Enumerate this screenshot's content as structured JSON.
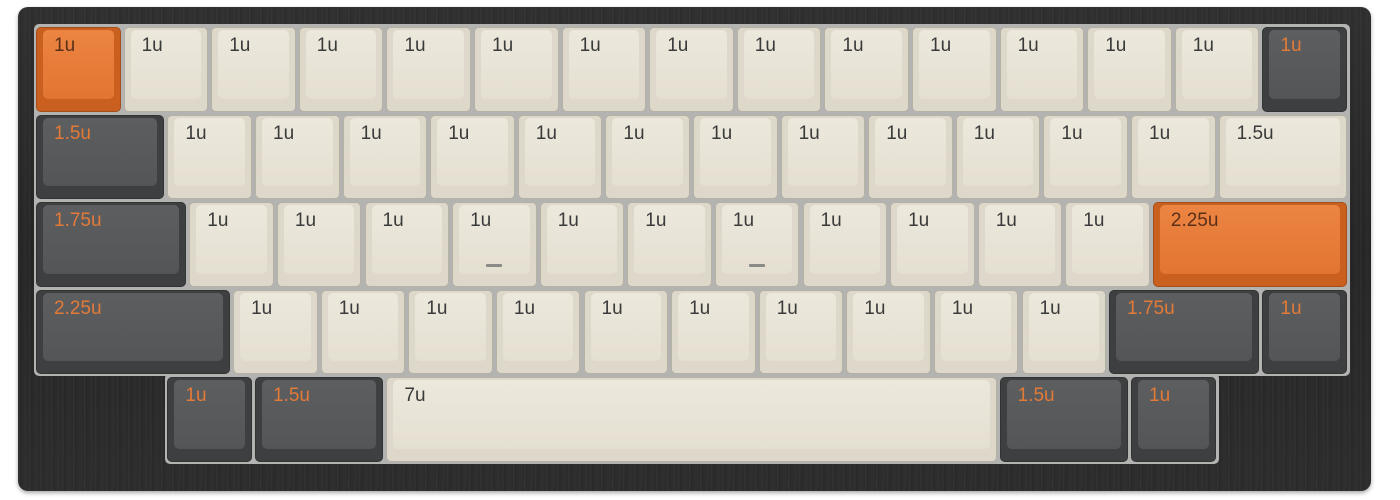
{
  "keyboard": {
    "colors": {
      "alpha_cap": "#ece8dc",
      "alpha_legend": "#3a3a3a",
      "modifier_cap": "#5c5e60",
      "modifier_legend": "#e37a38",
      "accent_cap": "#ec8442",
      "accent_legend": "#5a3018",
      "case": "#2b2b2b",
      "plate": "#b3b3b1"
    },
    "rows": [
      [
        {
          "legend": "1u",
          "width_u": 1,
          "color": "orange"
        },
        {
          "legend": "1u",
          "width_u": 1,
          "color": "beige"
        },
        {
          "legend": "1u",
          "width_u": 1,
          "color": "beige"
        },
        {
          "legend": "1u",
          "width_u": 1,
          "color": "beige"
        },
        {
          "legend": "1u",
          "width_u": 1,
          "color": "beige"
        },
        {
          "legend": "1u",
          "width_u": 1,
          "color": "beige"
        },
        {
          "legend": "1u",
          "width_u": 1,
          "color": "beige"
        },
        {
          "legend": "1u",
          "width_u": 1,
          "color": "beige"
        },
        {
          "legend": "1u",
          "width_u": 1,
          "color": "beige"
        },
        {
          "legend": "1u",
          "width_u": 1,
          "color": "beige"
        },
        {
          "legend": "1u",
          "width_u": 1,
          "color": "beige"
        },
        {
          "legend": "1u",
          "width_u": 1,
          "color": "beige"
        },
        {
          "legend": "1u",
          "width_u": 1,
          "color": "beige"
        },
        {
          "legend": "1u",
          "width_u": 1,
          "color": "beige"
        },
        {
          "legend": "1u",
          "width_u": 1,
          "color": "dark"
        }
      ],
      [
        {
          "legend": "1.5u",
          "width_u": 1.5,
          "color": "dark"
        },
        {
          "legend": "1u",
          "width_u": 1,
          "color": "beige"
        },
        {
          "legend": "1u",
          "width_u": 1,
          "color": "beige"
        },
        {
          "legend": "1u",
          "width_u": 1,
          "color": "beige"
        },
        {
          "legend": "1u",
          "width_u": 1,
          "color": "beige"
        },
        {
          "legend": "1u",
          "width_u": 1,
          "color": "beige"
        },
        {
          "legend": "1u",
          "width_u": 1,
          "color": "beige"
        },
        {
          "legend": "1u",
          "width_u": 1,
          "color": "beige"
        },
        {
          "legend": "1u",
          "width_u": 1,
          "color": "beige"
        },
        {
          "legend": "1u",
          "width_u": 1,
          "color": "beige"
        },
        {
          "legend": "1u",
          "width_u": 1,
          "color": "beige"
        },
        {
          "legend": "1u",
          "width_u": 1,
          "color": "beige"
        },
        {
          "legend": "1u",
          "width_u": 1,
          "color": "beige"
        },
        {
          "legend": "1.5u",
          "width_u": 1.5,
          "color": "beige"
        }
      ],
      [
        {
          "legend": "1.75u",
          "width_u": 1.75,
          "color": "dark"
        },
        {
          "legend": "1u",
          "width_u": 1,
          "color": "beige"
        },
        {
          "legend": "1u",
          "width_u": 1,
          "color": "beige"
        },
        {
          "legend": "1u",
          "width_u": 1,
          "color": "beige"
        },
        {
          "legend": "1u",
          "width_u": 1,
          "color": "beige",
          "homing": true
        },
        {
          "legend": "1u",
          "width_u": 1,
          "color": "beige"
        },
        {
          "legend": "1u",
          "width_u": 1,
          "color": "beige"
        },
        {
          "legend": "1u",
          "width_u": 1,
          "color": "beige",
          "homing": true
        },
        {
          "legend": "1u",
          "width_u": 1,
          "color": "beige"
        },
        {
          "legend": "1u",
          "width_u": 1,
          "color": "beige"
        },
        {
          "legend": "1u",
          "width_u": 1,
          "color": "beige"
        },
        {
          "legend": "1u",
          "width_u": 1,
          "color": "beige"
        },
        {
          "legend": "2.25u",
          "width_u": 2.25,
          "color": "orange"
        }
      ],
      [
        {
          "legend": "2.25u",
          "width_u": 2.25,
          "color": "dark"
        },
        {
          "legend": "1u",
          "width_u": 1,
          "color": "beige"
        },
        {
          "legend": "1u",
          "width_u": 1,
          "color": "beige"
        },
        {
          "legend": "1u",
          "width_u": 1,
          "color": "beige"
        },
        {
          "legend": "1u",
          "width_u": 1,
          "color": "beige"
        },
        {
          "legend": "1u",
          "width_u": 1,
          "color": "beige"
        },
        {
          "legend": "1u",
          "width_u": 1,
          "color": "beige"
        },
        {
          "legend": "1u",
          "width_u": 1,
          "color": "beige"
        },
        {
          "legend": "1u",
          "width_u": 1,
          "color": "beige"
        },
        {
          "legend": "1u",
          "width_u": 1,
          "color": "beige"
        },
        {
          "legend": "1u",
          "width_u": 1,
          "color": "beige"
        },
        {
          "legend": "1.75u",
          "width_u": 1.75,
          "color": "dark"
        },
        {
          "legend": "1u",
          "width_u": 1,
          "color": "dark"
        }
      ],
      [
        {
          "legend": "1u",
          "width_u": 1,
          "color": "dark"
        },
        {
          "legend": "1.5u",
          "width_u": 1.5,
          "color": "dark"
        },
        {
          "legend": "7u",
          "width_u": 7,
          "color": "beige"
        },
        {
          "legend": "1.5u",
          "width_u": 1.5,
          "color": "dark"
        },
        {
          "legend": "1u",
          "width_u": 1,
          "color": "dark"
        }
      ]
    ],
    "bottom_row_offset_u": 1.5
  }
}
